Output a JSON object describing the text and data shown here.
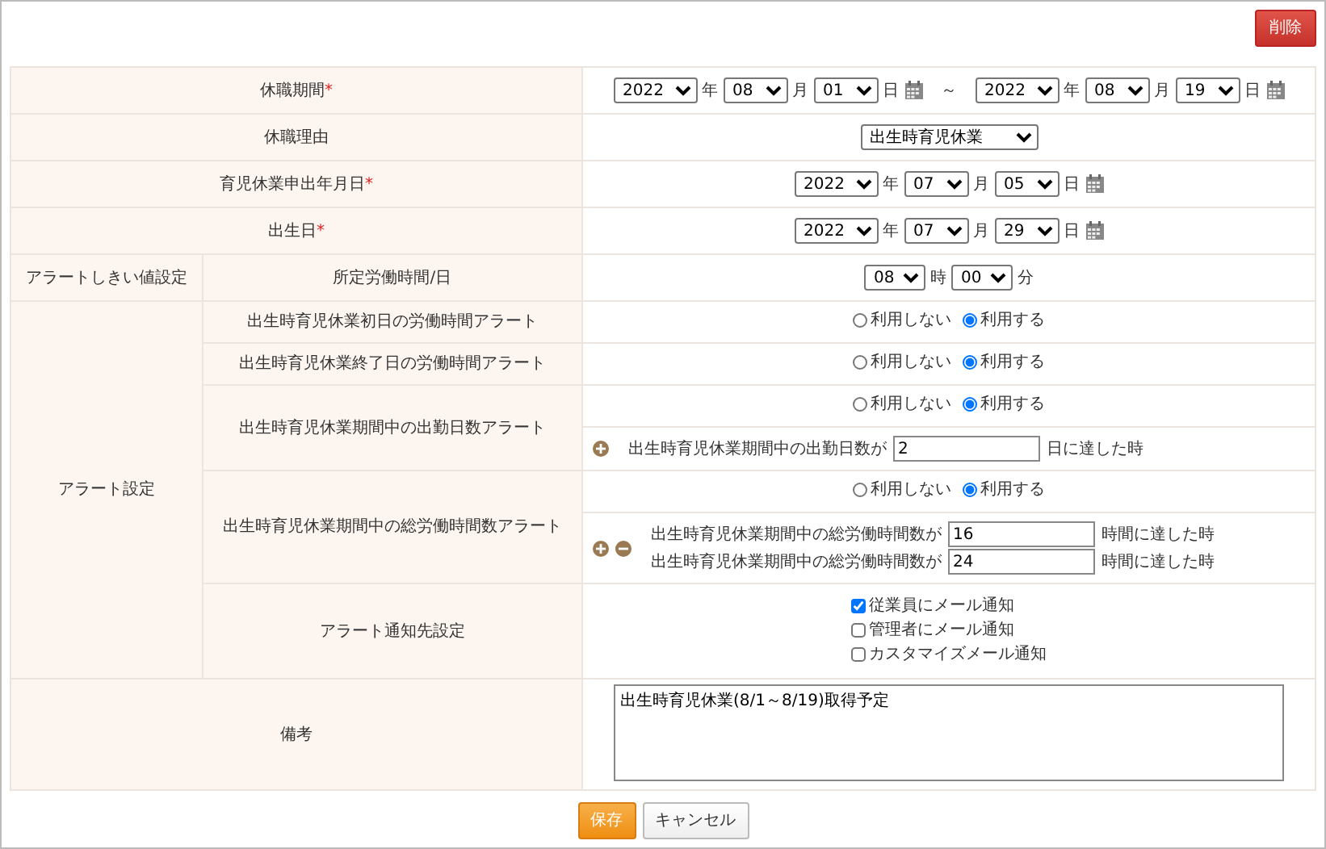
{
  "toolbar": {
    "delete_button": "削除"
  },
  "period": {
    "label": "休職期間",
    "required_mark": "*",
    "from": {
      "year": "2022",
      "year_unit": "年",
      "month": "08",
      "month_unit": "月",
      "day": "01",
      "day_unit": "日"
    },
    "separator": "～",
    "to": {
      "year": "2022",
      "year_unit": "年",
      "month": "08",
      "month_unit": "月",
      "day": "19",
      "day_unit": "日"
    }
  },
  "reason": {
    "label": "休職理由",
    "value": "出生時育児休業"
  },
  "application_date": {
    "label": "育児休業申出年月日",
    "required_mark": "*",
    "date": {
      "year": "2022",
      "year_unit": "年",
      "month": "07",
      "month_unit": "月",
      "day": "05",
      "day_unit": "日"
    }
  },
  "birth_date": {
    "label": "出生日",
    "required_mark": "*",
    "date": {
      "year": "2022",
      "year_unit": "年",
      "month": "07",
      "month_unit": "月",
      "day": "29",
      "day_unit": "日"
    }
  },
  "threshold": {
    "group_label": "アラートしきい値設定",
    "label": "所定労働時間/日",
    "hour": "08",
    "hour_unit": "時",
    "minute": "00",
    "minute_unit": "分"
  },
  "alerts": {
    "group_label": "アラート設定",
    "items": [
      {
        "label": "出生時育児休業初日の労働時間アラート",
        "options": [
          {
            "label": "利用しない",
            "selected": false
          },
          {
            "label": "利用する",
            "selected": true
          }
        ]
      },
      {
        "label": "出生時育児休業終了日の労働時間アラート",
        "options": [
          {
            "label": "利用しない",
            "selected": false
          },
          {
            "label": "利用する",
            "selected": true
          }
        ]
      },
      {
        "label": "出生時育児休業期間中の出勤日数アラート",
        "options": [
          {
            "label": "利用しない",
            "selected": false
          },
          {
            "label": "利用する",
            "selected": true
          }
        ],
        "add_button": true,
        "conditions": [
          {
            "prefix": "出生時育児休業期間中の出勤日数が",
            "value": "2",
            "suffix": "日に達した時"
          }
        ]
      },
      {
        "label": "出生時育児休業期間中の総労働時間数アラート",
        "options": [
          {
            "label": "利用しない",
            "selected": false
          },
          {
            "label": "利用する",
            "selected": true
          }
        ],
        "add_button": true,
        "remove_button": true,
        "conditions": [
          {
            "prefix": "出生時育児休業期間中の総労働時間数が",
            "value": "16",
            "suffix": "時間に達した時"
          },
          {
            "prefix": "出生時育児休業期間中の総労働時間数が",
            "value": "24",
            "suffix": "時間に達した時"
          }
        ]
      }
    ],
    "notify": {
      "label": "アラート通知先設定",
      "options": [
        {
          "label": "従業員にメール通知",
          "checked": true
        },
        {
          "label": "管理者にメール通知",
          "checked": false
        },
        {
          "label": "カスタマイズメール通知",
          "checked": false
        }
      ]
    }
  },
  "remarks": {
    "label": "備考",
    "value": "出生時育児休業(8/1～8/19)取得予定"
  },
  "footer_buttons": [
    {
      "label": "保存",
      "kind": "primary"
    },
    {
      "label": "キャンセル",
      "kind": "secondary"
    }
  ]
}
